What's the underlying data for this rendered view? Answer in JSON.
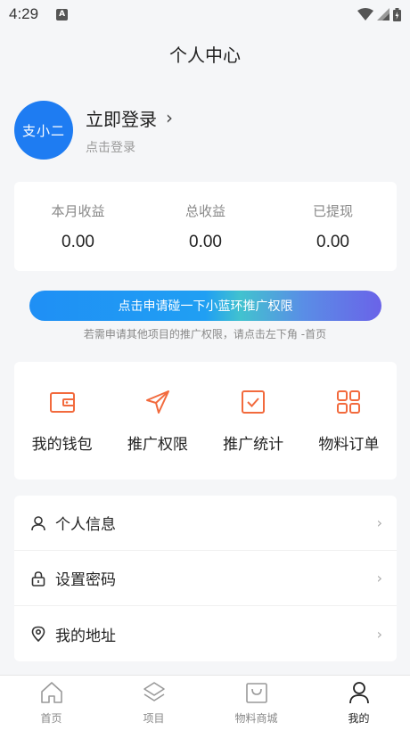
{
  "status_bar": {
    "time": "4:29",
    "notification_badge": "A"
  },
  "header": {
    "title": "个人中心"
  },
  "profile": {
    "avatar_text": "支小二",
    "login_title": "立即登录",
    "login_chevron": "›",
    "login_subtitle": "点击登录"
  },
  "earnings": [
    {
      "label": "本月收益",
      "value": "0.00"
    },
    {
      "label": "总收益",
      "value": "0.00"
    },
    {
      "label": "已提现",
      "value": "0.00"
    }
  ],
  "promo": {
    "button_label": "点击申请碰一下小蓝环推广权限",
    "note": "若需申请其他项目的推广权限，请点击左下角 -首页"
  },
  "functions": [
    {
      "label": "我的钱包",
      "icon": "wallet-icon"
    },
    {
      "label": "推广权限",
      "icon": "paper-plane-icon"
    },
    {
      "label": "推广统计",
      "icon": "checkbox-icon"
    },
    {
      "label": "物料订单",
      "icon": "grid-icon"
    }
  ],
  "menu": [
    {
      "label": "个人信息",
      "icon": "user-icon"
    },
    {
      "label": "设置密码",
      "icon": "lock-icon"
    },
    {
      "label": "我的地址",
      "icon": "location-pin-icon"
    }
  ],
  "menu_chevron": "›",
  "tabbar": [
    {
      "label": "首页",
      "icon": "home-icon",
      "active": false
    },
    {
      "label": "项目",
      "icon": "layers-icon",
      "active": false
    },
    {
      "label": "物料商城",
      "icon": "shopping-bag-icon",
      "active": false
    },
    {
      "label": "我的",
      "icon": "person-icon",
      "active": true
    }
  ],
  "colors": {
    "accent_orange": "#f26a3d",
    "avatar_blue": "#1e7cf2",
    "promo_gradient_start": "#1f8ff5",
    "promo_gradient_end": "#6a63e8"
  }
}
